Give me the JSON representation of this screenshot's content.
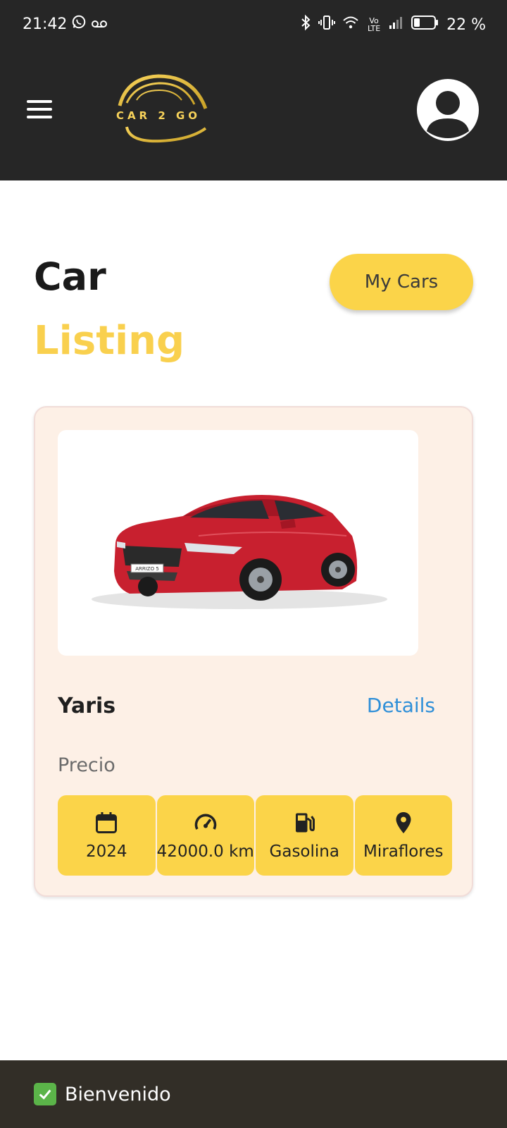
{
  "status_bar": {
    "time": "21:42",
    "battery": "22 %",
    "network_label": "Vo LTE",
    "icons": [
      "whatsapp-icon",
      "voicemail-icon",
      "bluetooth-icon",
      "vibrate-icon",
      "wifi-icon",
      "signal-icon",
      "battery-icon"
    ]
  },
  "header": {
    "logo_text": "CAR 2 GO",
    "menu_icon": "hamburger-menu-icon",
    "profile_icon": "account-circle-icon"
  },
  "page": {
    "title_line1": "Car",
    "title_line2": "Listing",
    "my_cars_button": "My Cars"
  },
  "listing": {
    "car_name": "Yaris",
    "details_link": "Details",
    "price_label": "Precio",
    "image_badge": "ARRIZO 5",
    "specs": [
      {
        "icon": "calendar-icon",
        "value": "2024"
      },
      {
        "icon": "speedometer-icon",
        "value": "42000.0 km"
      },
      {
        "icon": "fuel-pump-icon",
        "value": "Gasolina"
      },
      {
        "icon": "location-pin-icon",
        "value": "Miraflores"
      }
    ]
  },
  "snackbar": {
    "icon": "check-mark-icon",
    "message": "Bienvenido"
  },
  "colors": {
    "header_bg": "#262626",
    "accent_yellow": "#fbd449",
    "card_bg": "#fdf0e6",
    "link_blue": "#2e8fd8",
    "snackbar_bg": "#322e27"
  }
}
